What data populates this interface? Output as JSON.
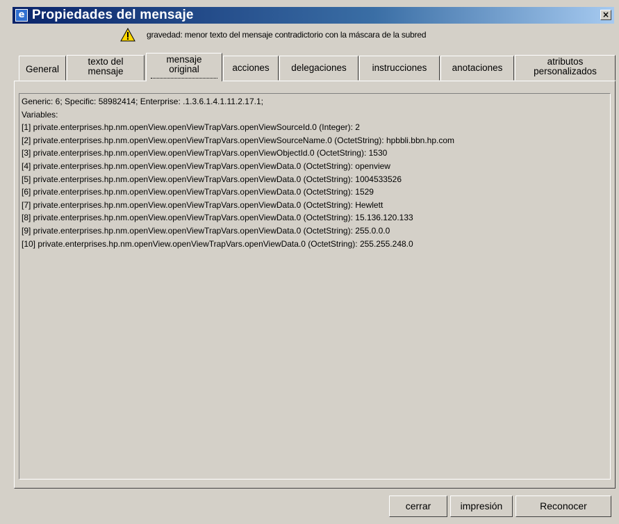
{
  "window": {
    "title": "Propiedades del mensaje",
    "close_label": "×"
  },
  "warning": {
    "icon": "warning-icon",
    "text": "gravedad: menor texto del mensaje contradictorio con la máscara de la subred"
  },
  "tabs": [
    {
      "label_lines": [
        "General"
      ],
      "selected": false
    },
    {
      "label_lines": [
        "texto del",
        "mensaje"
      ],
      "selected": false
    },
    {
      "label_lines": [
        "mensaje",
        "original"
      ],
      "selected": true
    },
    {
      "label_lines": [
        "acciones"
      ],
      "selected": false
    },
    {
      "label_lines": [
        "delegaciones"
      ],
      "selected": false
    },
    {
      "label_lines": [
        "instrucciones"
      ],
      "selected": false
    },
    {
      "label_lines": [
        "anotaciones"
      ],
      "selected": false
    },
    {
      "label_lines": [
        "atributos",
        "personalizados"
      ],
      "selected": false
    }
  ],
  "message": {
    "lines": [
      "Generic: 6; Specific: 58982414; Enterprise: .1.3.6.1.4.1.11.2.17.1;",
      "Variables:",
      "[1] private.enterprises.hp.nm.openView.openViewTrapVars.openViewSourceId.0 (Integer): 2",
      "[2] private.enterprises.hp.nm.openView.openViewTrapVars.openViewSourceName.0 (OctetString): hpbbli.bbn.hp.com",
      "[3] private.enterprises.hp.nm.openView.openViewTrapVars.openViewObjectId.0 (OctetString): 1530",
      "[4] private.enterprises.hp.nm.openView.openViewTrapVars.openViewData.0 (OctetString): openview",
      "[5] private.enterprises.hp.nm.openView.openViewTrapVars.openViewData.0 (OctetString): 1004533526",
      "[6] private.enterprises.hp.nm.openView.openViewTrapVars.openViewData.0 (OctetString): 1529",
      "[7] private.enterprises.hp.nm.openView.openViewTrapVars.openViewData.0 (OctetString): Hewlett",
      "[8] private.enterprises.hp.nm.openView.openViewTrapVars.openViewData.0 (OctetString): 15.136.120.133",
      "[9] private.enterprises.hp.nm.openView.openViewTrapVars.openViewData.0 (OctetString): 255.0.0.0",
      "[10] private.enterprises.hp.nm.openView.openViewTrapVars.openViewData.0 (OctetString): 255.255.248.0"
    ]
  },
  "buttons": {
    "close": "cerrar",
    "print": "impresión",
    "acknowledge": "Reconocer"
  }
}
